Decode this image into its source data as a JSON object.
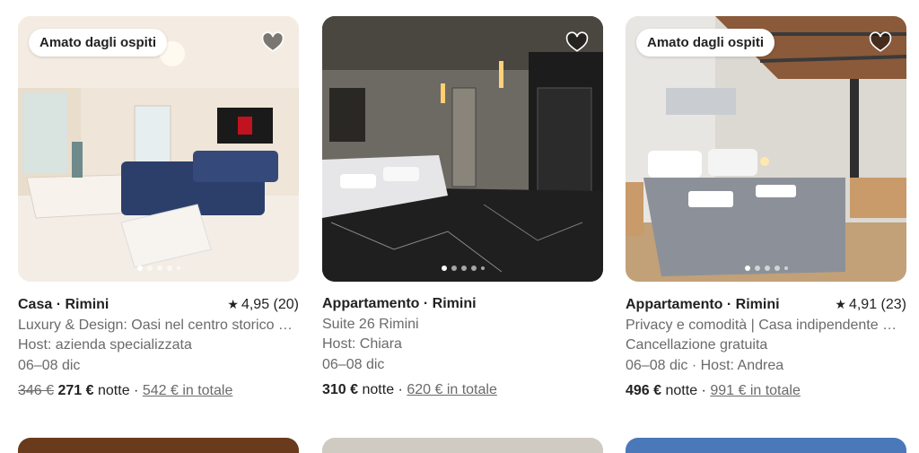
{
  "listings": [
    {
      "badge": "Amato dagli ospiti",
      "title": "Casa · Rimini",
      "rating": "4,95 (20)",
      "description": "Luxury & Design: Oasi nel centro storico …",
      "line2": "Host: azienda specializzata",
      "line3": "06–08 dic",
      "old_price": "346 €",
      "price": "271 €",
      "per_night": "notte",
      "separator": "·",
      "total": "542 € in totale",
      "heart_icon": "heart-icon",
      "dots": 5,
      "active_dot": 0
    },
    {
      "title": "Appartamento · Rimini",
      "description": "Suite 26 Rimini",
      "line2": "Host: Chiara",
      "line3": "06–08 dic",
      "price": "310 €",
      "per_night": "notte",
      "separator": "·",
      "total": "620 € in totale",
      "heart_icon": "heart-icon",
      "dots": 5,
      "active_dot": 0
    },
    {
      "badge": "Amato dagli ospiti",
      "title": "Appartamento · Rimini",
      "rating": "4,91 (23)",
      "description": "Privacy e comodità | Casa indipendente …",
      "line2": "Cancellazione gratuita",
      "line3": "06–08 dic · Host: Andrea",
      "price": "496 €",
      "per_night": "notte",
      "separator": "·",
      "total": "991 € in totale",
      "heart_icon": "heart-icon",
      "dots": 5,
      "active_dot": 0
    }
  ],
  "rating_icon": "star-icon"
}
